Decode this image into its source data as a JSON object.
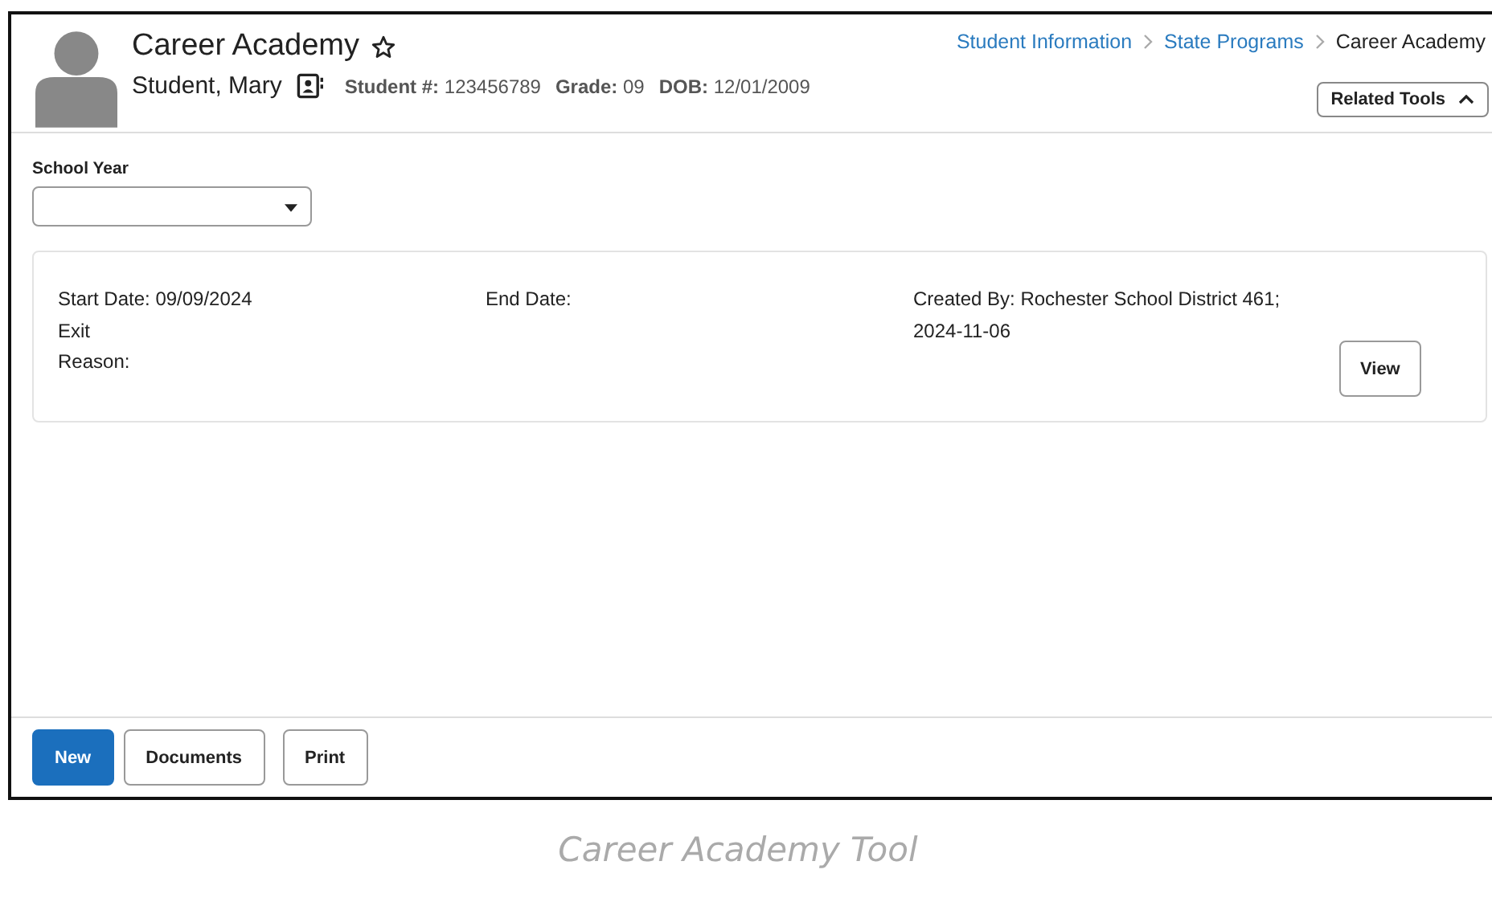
{
  "header": {
    "title": "Career Academy",
    "student_name": "Student, Mary",
    "fields": [
      {
        "label": "Student #:",
        "value": "123456789"
      },
      {
        "label": "Grade:",
        "value": "09"
      },
      {
        "label": "DOB:",
        "value": "12/01/2009"
      }
    ],
    "breadcrumbs": [
      {
        "label": "Student Information",
        "kind": "link"
      },
      {
        "label": "State Programs",
        "kind": "link"
      },
      {
        "label": "Career Academy",
        "kind": "current"
      }
    ],
    "related_tools": {
      "label": "Related Tools",
      "expanded": true
    }
  },
  "school_year": {
    "label": "School Year"
  },
  "records": [
    {
      "columns": [
        [
          "Start Date: 09/09/2024",
          "Exit",
          "Reason:"
        ],
        [
          "End Date:"
        ],
        [
          "Created By: Rochester School District 461;",
          "2024-11-06"
        ]
      ],
      "button": "View"
    }
  ],
  "footer_buttons": [
    {
      "label": "New",
      "primary": true
    },
    {
      "label": "Documents",
      "primary": false
    },
    {
      "label": "Print",
      "primary": false
    }
  ],
  "caption": "Career Academy Tool"
}
